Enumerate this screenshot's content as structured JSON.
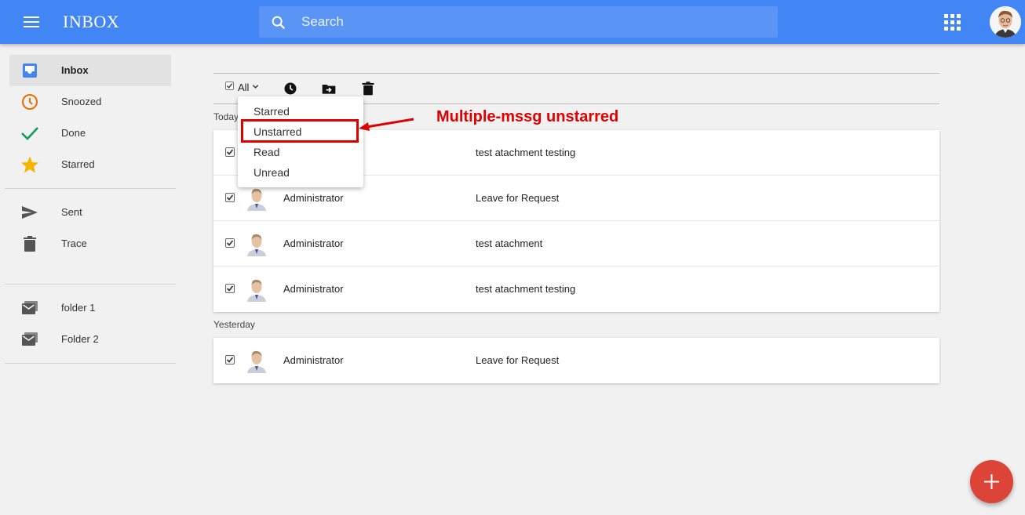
{
  "header": {
    "title": "INBOX",
    "search_placeholder": "Search"
  },
  "sidebar": {
    "items": [
      {
        "label": "Inbox",
        "icon": "inbox-icon",
        "color": "#4285f4",
        "active": true
      },
      {
        "label": "Snoozed",
        "icon": "clock-icon",
        "color": "#ef6c00"
      },
      {
        "label": "Done",
        "icon": "check-icon",
        "color": "#0f9d58"
      },
      {
        "label": "Starred",
        "icon": "star-icon",
        "color": "#f4b400"
      },
      {
        "label": "Sent",
        "icon": "send-icon",
        "color": "#555555"
      },
      {
        "label": "Trace",
        "icon": "trash-icon",
        "color": "#555555"
      },
      {
        "label": "folder 1",
        "icon": "folder-mail-icon",
        "color": "#555555"
      },
      {
        "label": "Folder 2",
        "icon": "folder-mail-icon",
        "color": "#555555"
      }
    ]
  },
  "toolbar": {
    "select_label": "All"
  },
  "dropdown": {
    "items": [
      "Starred",
      "Unstarred",
      "Read",
      "Unread"
    ],
    "highlighted": "Unstarred"
  },
  "annotation": {
    "text": "Multiple-mssg unstarred",
    "color": "#e10000"
  },
  "sections": [
    {
      "label": "Today",
      "emails": [
        {
          "sender": "",
          "subject": "test atachment testing",
          "checked": true
        },
        {
          "sender": "Administrator",
          "subject": "Leave for Request",
          "checked": true
        },
        {
          "sender": "Administrator",
          "subject": "test atachment",
          "checked": true
        },
        {
          "sender": "Administrator",
          "subject": "test atachment testing",
          "checked": true
        }
      ]
    },
    {
      "label": "Yesterday",
      "emails": [
        {
          "sender": "Administrator",
          "subject": "Leave for Request",
          "checked": true
        }
      ]
    }
  ],
  "colors": {
    "topbar": "#4285f4",
    "fab": "#db4437"
  }
}
